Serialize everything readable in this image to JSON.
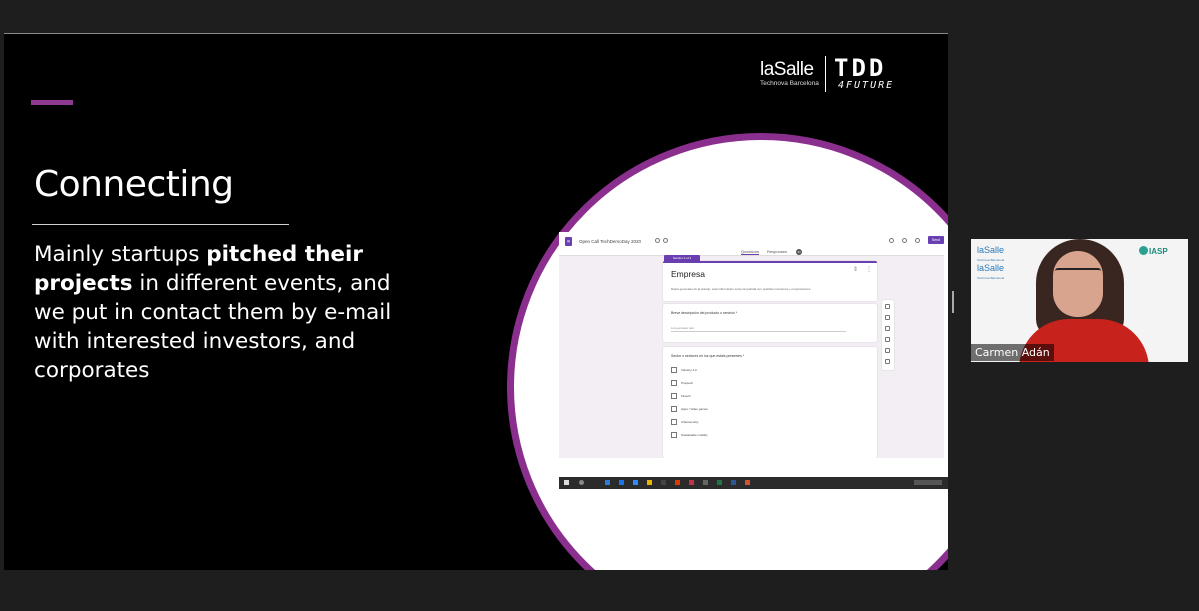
{
  "slide": {
    "title": "Connecting",
    "body_parts": [
      {
        "text": "Mainly startups ",
        "bold": false
      },
      {
        "text": "pitched their projects",
        "bold": true
      },
      {
        "text": " in different events, and we put in contact them by e-mail with interested investors, and corporates",
        "bold": false
      }
    ],
    "logo_lasalle": "laSalle",
    "logo_lasalle_sub": "Technova Barcelona",
    "logo_tdd": "TDD",
    "logo_tdd_sub": "4FUTURE",
    "colors": {
      "accent": "#8e3a93",
      "circle_border": "#8b2f8f",
      "background": "#000000"
    }
  },
  "embedded_form": {
    "form_title": "Open Call TechDemoDay 2020",
    "send_label": "Send",
    "tabs": [
      "Questions",
      "Responses"
    ],
    "responses_count": "31",
    "section_tag": "Section 2 of 3",
    "card_title": "Empresa",
    "card_desc": "Datos generales de la startup, esta información será compartida con posibles inversores y corporaciones",
    "q1": "Breve descripción del producto o servicio *",
    "q1_placeholder": "Long answer text",
    "q2": "Sector o sectores en los que estáis presentes *",
    "options": [
      "Industry 4.0",
      "Proptech",
      "Fintech",
      "Apps / Video games",
      "Cibersecurity",
      "Sustainable mobility"
    ]
  },
  "video": {
    "speaker_name": "Carmen Adán",
    "logo1": "laSalle",
    "logo1_sub": "Technova Barcelona",
    "logo2": "laSalle",
    "logo2_sub": "Technova Barcelona",
    "iasp": "IASP"
  }
}
